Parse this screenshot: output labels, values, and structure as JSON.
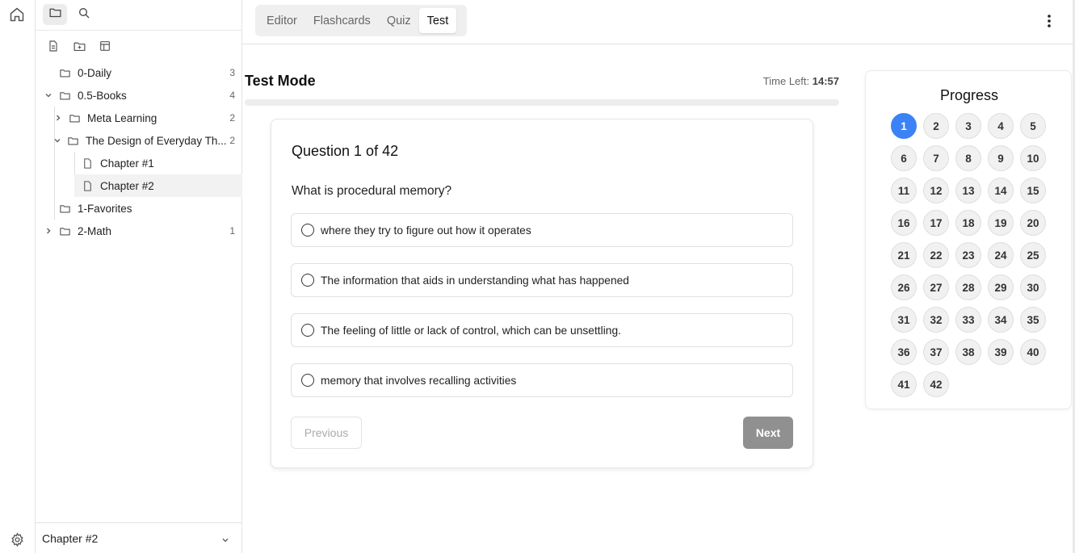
{
  "ribbon": {
    "home_icon": "home-icon",
    "settings_icon": "gear-icon"
  },
  "sidebar": {
    "tabs": [
      {
        "name": "folder-icon",
        "active": true
      },
      {
        "name": "search-icon",
        "active": false
      }
    ],
    "actions": [
      "new-note-icon",
      "new-folder-icon",
      "layout-icon"
    ],
    "tree": [
      {
        "label": "0-Daily",
        "count": "3",
        "depth": 0,
        "type": "folder",
        "expand": "none"
      },
      {
        "label": "0.5-Books",
        "count": "4",
        "depth": 0,
        "type": "folder",
        "expand": "open"
      },
      {
        "label": "Meta Learning",
        "count": "2",
        "depth": 1,
        "type": "folder",
        "expand": "closed"
      },
      {
        "label": "The Design of Everyday Th...",
        "count": "2",
        "depth": 1,
        "type": "folder",
        "expand": "open"
      },
      {
        "label": "Chapter #1",
        "count": "",
        "depth": 2,
        "type": "file",
        "expand": "none"
      },
      {
        "label": "Chapter #2",
        "count": "",
        "depth": 2,
        "type": "file",
        "expand": "none",
        "selected": true
      },
      {
        "label": "1-Favorites",
        "count": "",
        "depth": 0,
        "type": "folder",
        "expand": "none"
      },
      {
        "label": "2-Math",
        "count": "1",
        "depth": 0,
        "type": "folder",
        "expand": "closed"
      }
    ],
    "bottom_label": "Chapter #2"
  },
  "topbar": {
    "tabs": [
      {
        "label": "Editor",
        "active": false
      },
      {
        "label": "Flashcards",
        "active": false
      },
      {
        "label": "Quiz",
        "active": false
      },
      {
        "label": "Test",
        "active": true
      }
    ]
  },
  "test": {
    "title": "Test Mode",
    "timer_label": "Time Left:",
    "timer_value": "14:57",
    "question_number": "Question 1 of 42",
    "question": "What is procedural memory?",
    "options": [
      "where they try to figure out how it operates",
      "The information that aids in understanding what has happened",
      "The feeling of little or lack of control, which can be unsettling.",
      "memory that involves recalling activities"
    ],
    "prev_label": "Previous",
    "next_label": "Next"
  },
  "progress": {
    "title": "Progress",
    "total": 42,
    "current": 1,
    "answered_fraction": 0,
    "accent": "#3b82f6"
  }
}
